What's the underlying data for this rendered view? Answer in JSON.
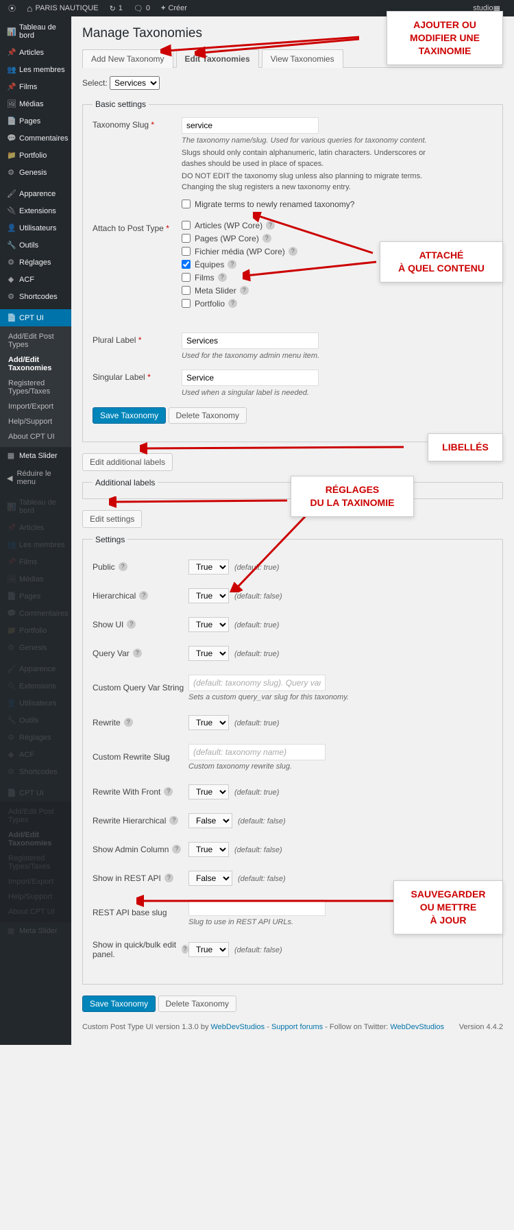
{
  "adminbar": {
    "site": "PARIS NAUTIQUE",
    "updates": "1",
    "comments": "0",
    "new": "Créer",
    "user": "studio"
  },
  "sidebar": {
    "items": [
      {
        "icon": "📊",
        "label": "Tableau de bord"
      },
      {
        "icon": "📌",
        "label": "Articles"
      },
      {
        "icon": "👥",
        "label": "Les membres"
      },
      {
        "icon": "📌",
        "label": "Films"
      },
      {
        "icon": "🖼",
        "label": "Médias"
      },
      {
        "icon": "📄",
        "label": "Pages"
      },
      {
        "icon": "💬",
        "label": "Commentaires"
      },
      {
        "icon": "📁",
        "label": "Portfolio"
      },
      {
        "icon": "⚙",
        "label": "Genesis",
        "sep_after": true
      },
      {
        "icon": "🖌",
        "label": "Apparence"
      },
      {
        "icon": "🔌",
        "label": "Extensions"
      },
      {
        "icon": "👤",
        "label": "Utilisateurs"
      },
      {
        "icon": "🔧",
        "label": "Outils"
      },
      {
        "icon": "⚙",
        "label": "Réglages"
      },
      {
        "icon": "◆",
        "label": "ACF"
      },
      {
        "icon": "⚙",
        "label": "Shortcodes",
        "sep_after": true
      },
      {
        "icon": "📄",
        "label": "CPT UI",
        "current": true
      },
      {
        "icon": "▦",
        "label": "Meta Slider"
      }
    ],
    "submenu": [
      {
        "label": "Add/Edit Post Types"
      },
      {
        "label": "Add/Edit Taxonomies",
        "current": true
      },
      {
        "label": "Registered Types/Taxes"
      },
      {
        "label": "Import/Export"
      },
      {
        "label": "Help/Support"
      },
      {
        "label": "About CPT UI"
      }
    ],
    "collapse": "Réduire le menu"
  },
  "page": {
    "title": "Manage Taxonomies",
    "tabs": [
      "Add New Taxonomy",
      "Edit Taxonomies",
      "View Taxonomies"
    ],
    "active_tab": 1,
    "select_label": "Select:",
    "select_value": "Services"
  },
  "basic": {
    "legend": "Basic settings",
    "slug_label": "Taxonomy Slug",
    "slug_value": "service",
    "slug_desc": "The taxonomy name/slug. Used for various queries for taxonomy content.",
    "slug_warn1": "Slugs should only contain alphanumeric, latin characters. Underscores or dashes should be used in place of spaces.",
    "slug_warn2": "DO NOT EDIT the taxonomy slug unless also planning to migrate terms. Changing the slug registers a new taxonomy entry.",
    "migrate_label": "Migrate terms to newly renamed taxonomy?",
    "attach_label": "Attach to Post Type",
    "post_types": [
      {
        "label": "Articles (WP Core)",
        "checked": false,
        "help": true
      },
      {
        "label": "Pages (WP Core)",
        "checked": false,
        "help": true
      },
      {
        "label": "Fichier média (WP Core)",
        "checked": false,
        "help": true
      },
      {
        "label": "Équipes",
        "checked": true,
        "help": true
      },
      {
        "label": "Films",
        "checked": false,
        "help": true
      },
      {
        "label": "Meta Slider",
        "checked": false,
        "help": true
      },
      {
        "label": "Portfolio",
        "checked": false,
        "help": true
      }
    ],
    "plural_label": "Plural Label",
    "plural_value": "Services",
    "plural_desc": "Used for the taxonomy admin menu item.",
    "singular_label": "Singular Label",
    "singular_value": "Service",
    "singular_desc": "Used when a singular label is needed.",
    "save_btn": "Save Taxonomy",
    "delete_btn": "Delete Taxonomy"
  },
  "additional": {
    "btn": "Edit additional labels",
    "legend": "Additional labels"
  },
  "settings_section": {
    "btn": "Edit settings",
    "legend": "Settings"
  },
  "settings": [
    {
      "label": "Public",
      "help": true,
      "type": "select",
      "value": "True",
      "hint": "(default: true)"
    },
    {
      "label": "Hierarchical",
      "help": true,
      "type": "select",
      "value": "True",
      "hint": "(default: false)"
    },
    {
      "label": "Show UI",
      "help": true,
      "type": "select",
      "value": "True",
      "hint": "(default: true)"
    },
    {
      "label": "Query Var",
      "help": true,
      "type": "select",
      "value": "True",
      "hint": "(default: true)"
    },
    {
      "label": "Custom Query Var String",
      "help": false,
      "type": "text",
      "placeholder": "(default: taxonomy slug). Query var needs to b",
      "below": "Sets a custom query_var slug for this taxonomy."
    },
    {
      "label": "Rewrite",
      "help": true,
      "type": "select",
      "value": "True",
      "hint": "(default: true)"
    },
    {
      "label": "Custom Rewrite Slug",
      "help": false,
      "type": "text",
      "placeholder": "(default: taxonomy name)",
      "below": "Custom taxonomy rewrite slug."
    },
    {
      "label": "Rewrite With Front",
      "help": true,
      "type": "select",
      "value": "True",
      "hint": "(default: true)"
    },
    {
      "label": "Rewrite Hierarchical",
      "help": true,
      "type": "select",
      "value": "False",
      "hint": "(default: false)"
    },
    {
      "label": "Show Admin Column",
      "help": true,
      "type": "select",
      "value": "True",
      "hint": "(default: false)"
    },
    {
      "label": "Show in REST API",
      "help": true,
      "type": "select",
      "value": "False",
      "hint": "(default: false)"
    },
    {
      "label": "REST API base slug",
      "help": false,
      "type": "text",
      "placeholder": "",
      "below": "Slug to use in REST API URLs."
    },
    {
      "label": "Show in quick/bulk edit panel.",
      "help": true,
      "type": "select",
      "value": "True",
      "hint": "(default: false)"
    }
  ],
  "bottom": {
    "save": "Save Taxonomy",
    "delete": "Delete Taxonomy"
  },
  "footer": {
    "left_pre": "Custom Post Type UI version 1.3.0 by ",
    "link1": "WebDevStudios",
    "sep": " - ",
    "link2": "Support forums",
    "mid": " - Follow on Twitter: ",
    "link3": "WebDevStudios",
    "version": "Version 4.4.2"
  },
  "callouts": {
    "c1": "AJOUTER OU\nMODIFIER UNE\nTAXINOMIE",
    "c2": "ATTACHÉ\nÀ QUEL CONTENU",
    "c3": "LIBELLÉS",
    "c4": "RÉGLAGES\nDU LA TAXINOMIE",
    "c5": "SAUVEGARDER\nOU METTRE\nÀ JOUR"
  }
}
